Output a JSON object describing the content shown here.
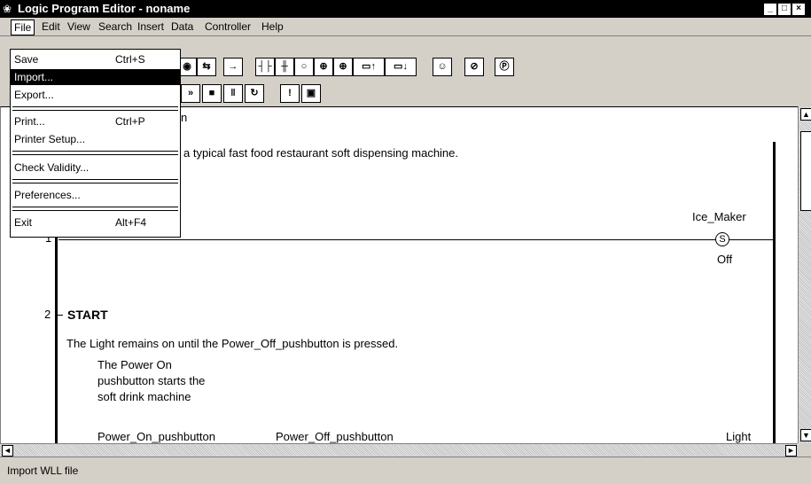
{
  "window": {
    "title": "Logic Program Editor - noname"
  },
  "menubar": {
    "items": [
      "File",
      "Edit",
      "View",
      "Search",
      "Insert",
      "Data",
      "Controller",
      "Help"
    ]
  },
  "file_menu": {
    "items": [
      {
        "label": "Save",
        "shortcut": "Ctrl+S"
      },
      {
        "label": "Import...",
        "shortcut": ""
      },
      {
        "label": "Export...",
        "shortcut": ""
      },
      {
        "label": "Print...",
        "shortcut": "Ctrl+P"
      },
      {
        "label": "Printer Setup...",
        "shortcut": ""
      },
      {
        "label": "Check Validity...",
        "shortcut": ""
      },
      {
        "label": "Preferences...",
        "shortcut": ""
      },
      {
        "label": "Exit",
        "shortcut": "Alt+F4"
      }
    ],
    "highlighted": "Import..."
  },
  "editor": {
    "partial_header": "n",
    "description_fragment": "a typical fast food restaurant soft dispensing machine.",
    "rung1": {
      "number": "1",
      "coil_label": "Ice_Maker",
      "coil_symbol": "S",
      "coil_state": "Off"
    },
    "rung2": {
      "number": "2",
      "title": "START",
      "comment": "The Light remains on until the Power_Off_pushbutton is pressed.",
      "note_lines": [
        "The Power On",
        "pushbutton starts the",
        "soft drink machine"
      ],
      "contact1": "Power_On_pushbutton",
      "contact2": "Power_Off_pushbutton",
      "coil_label": "Light"
    }
  },
  "statusbar": {
    "text": "Import WLL file"
  }
}
